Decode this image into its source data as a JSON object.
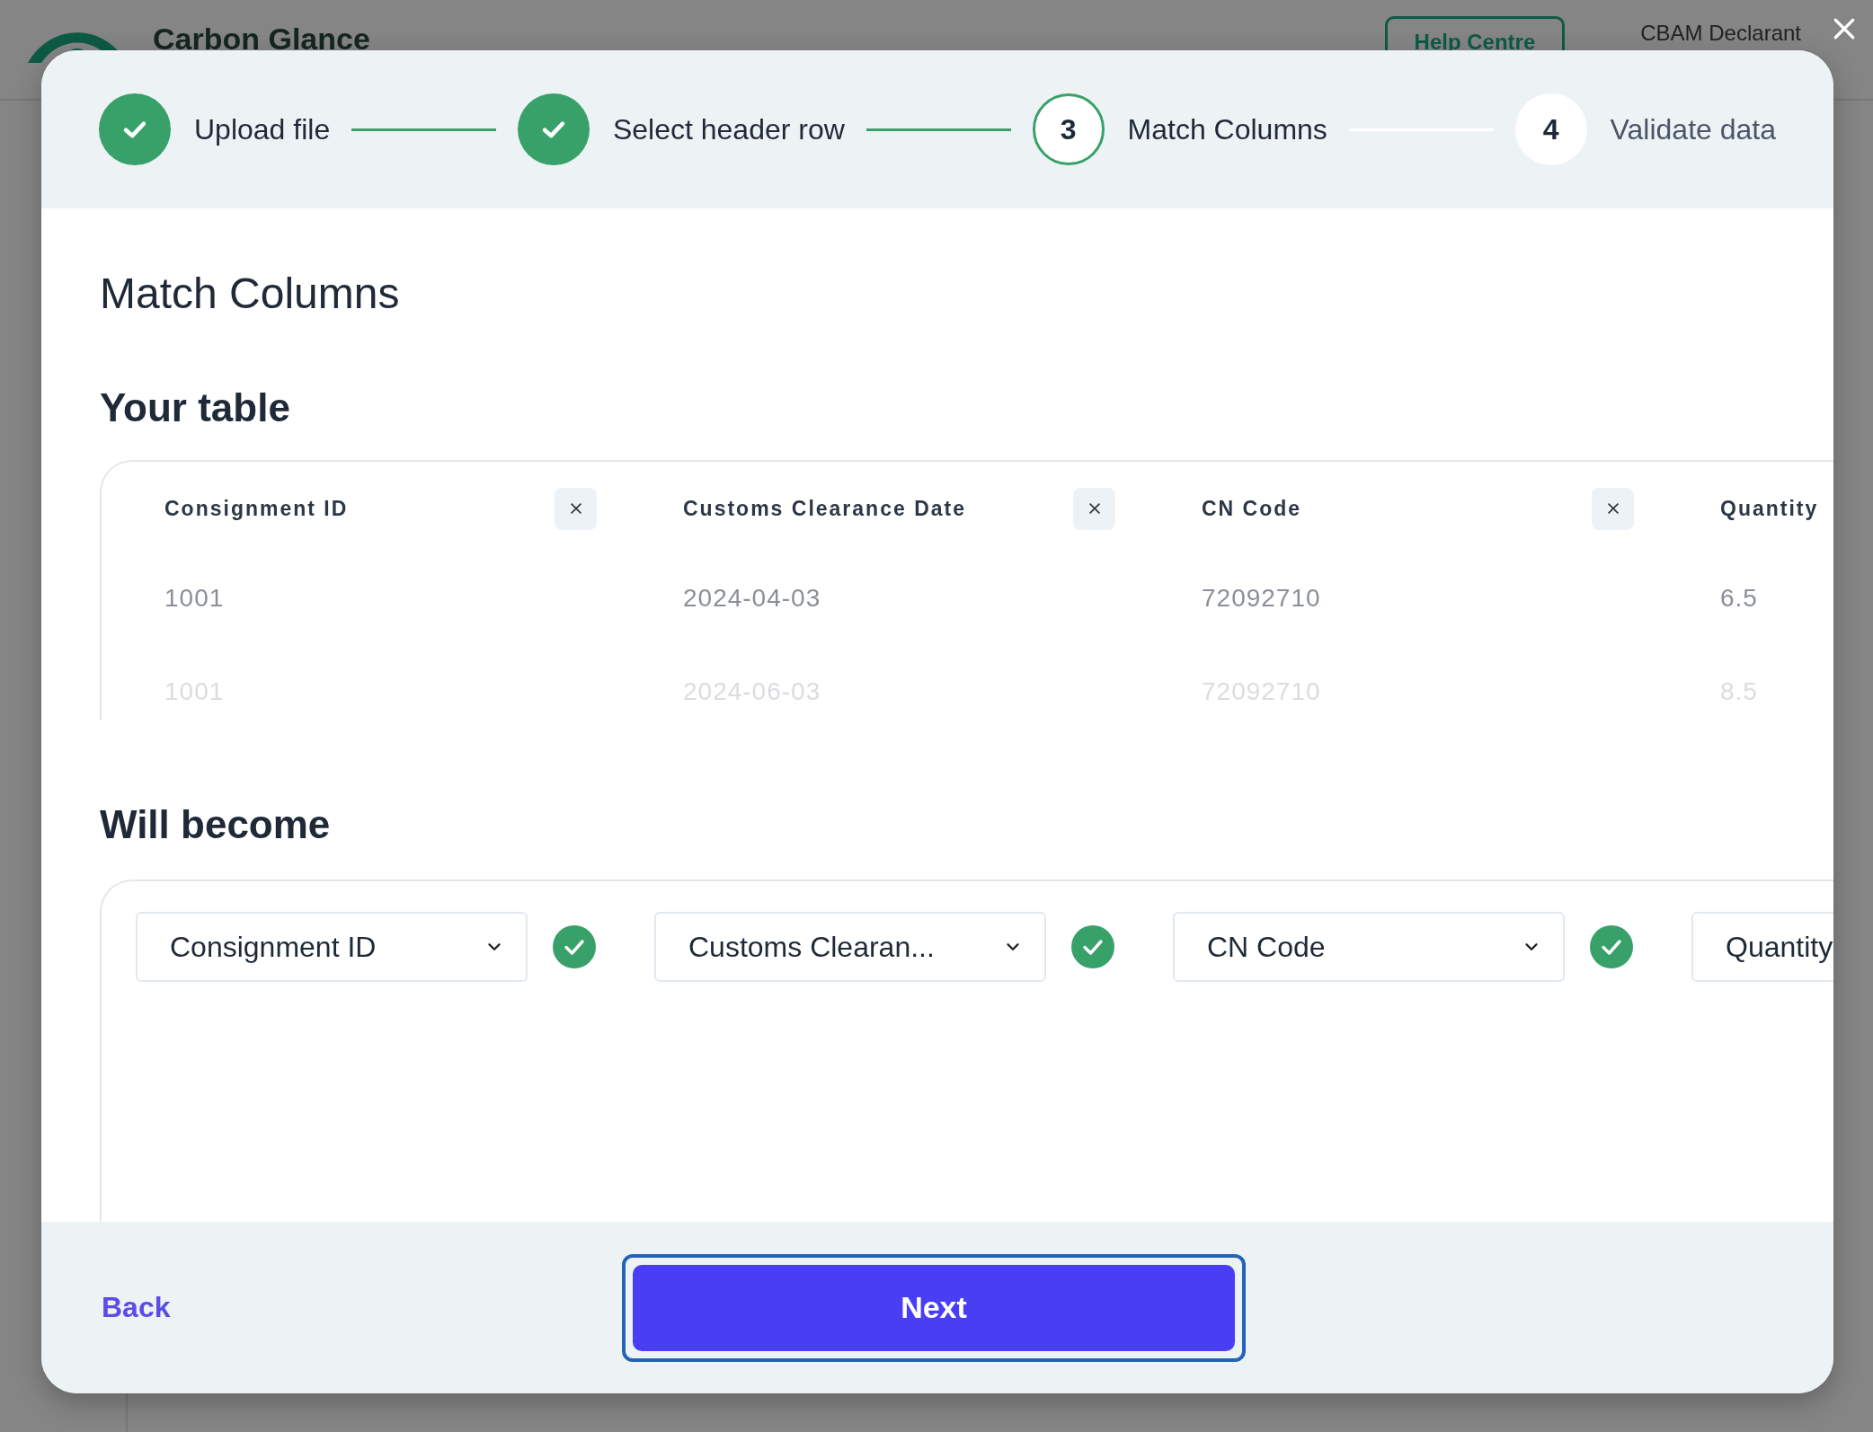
{
  "background": {
    "app_name": "Carbon Glance",
    "help_button": "Help Centre",
    "account_menu": "CBAM Declarant"
  },
  "steps": [
    {
      "label": "Upload file",
      "completed": true,
      "selected": false
    },
    {
      "label": "Select header row",
      "completed": true,
      "selected": false
    },
    {
      "number": "3",
      "label": "Match Columns",
      "completed": false,
      "selected": true
    },
    {
      "number": "4",
      "label": "Validate data",
      "completed": false,
      "selected": false
    }
  ],
  "title": "Match Columns",
  "your_table": {
    "heading": "Your table",
    "columns": [
      {
        "name": "Consignment ID",
        "removable": true
      },
      {
        "name": "Customs Clearance Date",
        "removable": true
      },
      {
        "name": "CN Code",
        "removable": true
      },
      {
        "name": "Quantity"
      }
    ],
    "rows": [
      {
        "cells": [
          "1001",
          "2024-04-03",
          "72092710",
          "6.5"
        ],
        "faded": false
      },
      {
        "cells": [
          "1001",
          "2024-06-03",
          "72092710",
          "8.5"
        ],
        "faded": true
      }
    ]
  },
  "will_become": {
    "heading": "Will become",
    "matches": [
      {
        "value": "Consignment ID",
        "caret": true,
        "matched": true
      },
      {
        "value": "Customs Clearan...",
        "caret": true,
        "matched": true
      },
      {
        "value": "CN Code",
        "caret": true,
        "matched": true
      },
      {
        "value": "Quantity"
      }
    ]
  },
  "footer": {
    "back": "Back",
    "next": "Next"
  }
}
